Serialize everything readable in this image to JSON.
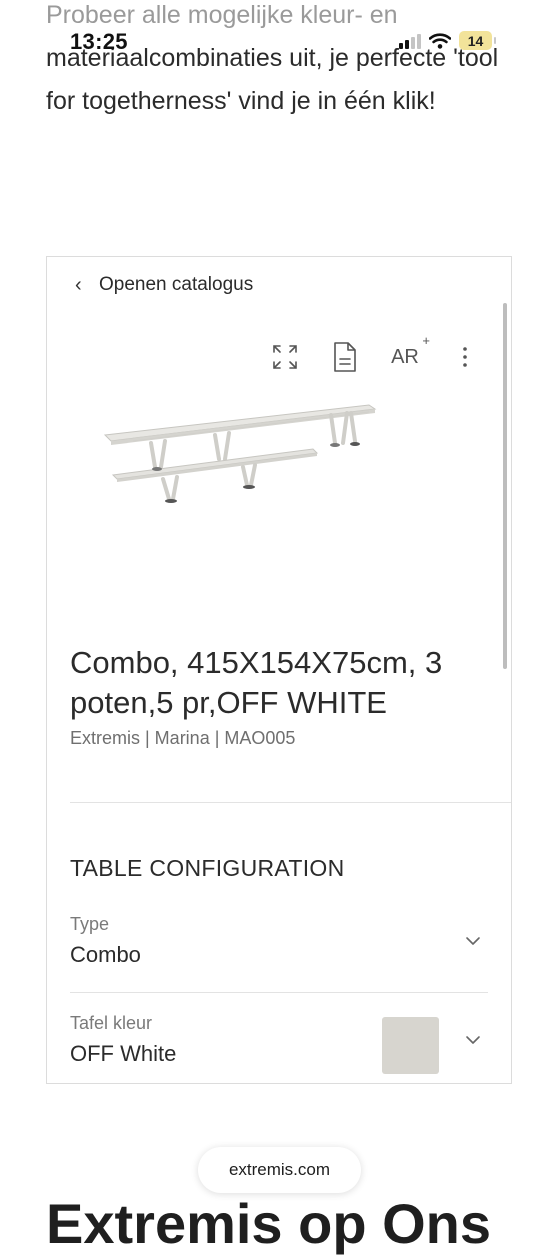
{
  "status_bar": {
    "time": "13:25",
    "battery_level": "14",
    "icons": [
      "cellular-signal-icon",
      "wifi-icon",
      "battery-icon"
    ]
  },
  "intro": {
    "line_faded": "Probeer alle mogelijke kleur- en",
    "line_rest": "materiaalcombinaties uit, je perfecte 'tool for togetherness' vind je in één klik!"
  },
  "viewer": {
    "back_label": "Openen catalogus",
    "toolbar": {
      "icons": [
        "fullscreen-icon",
        "document-icon",
        "ar-icon",
        "more-vertical-icon"
      ],
      "ar_label": "AR",
      "ar_sup": "+"
    },
    "product": {
      "title": "Combo, 415X154X75cm, 3 poten,5 pr,OFF WHITE",
      "meta": "Extremis | Marina | MAO005"
    },
    "configuration": {
      "heading": "TABLE CONFIGURATION",
      "options": [
        {
          "label": "Type",
          "value": "Combo"
        },
        {
          "label": "Tafel kleur",
          "value": "OFF White",
          "swatch_color": "#d7d5cf"
        }
      ]
    }
  },
  "browser": {
    "url": "extremis.com"
  },
  "next_section": {
    "heading_partial": "Extremis op Ons"
  },
  "colors": {
    "text": "#2b2b2b",
    "muted": "#7a7a7a",
    "border": "#dcdcdc",
    "battery": "#f2e39a"
  }
}
